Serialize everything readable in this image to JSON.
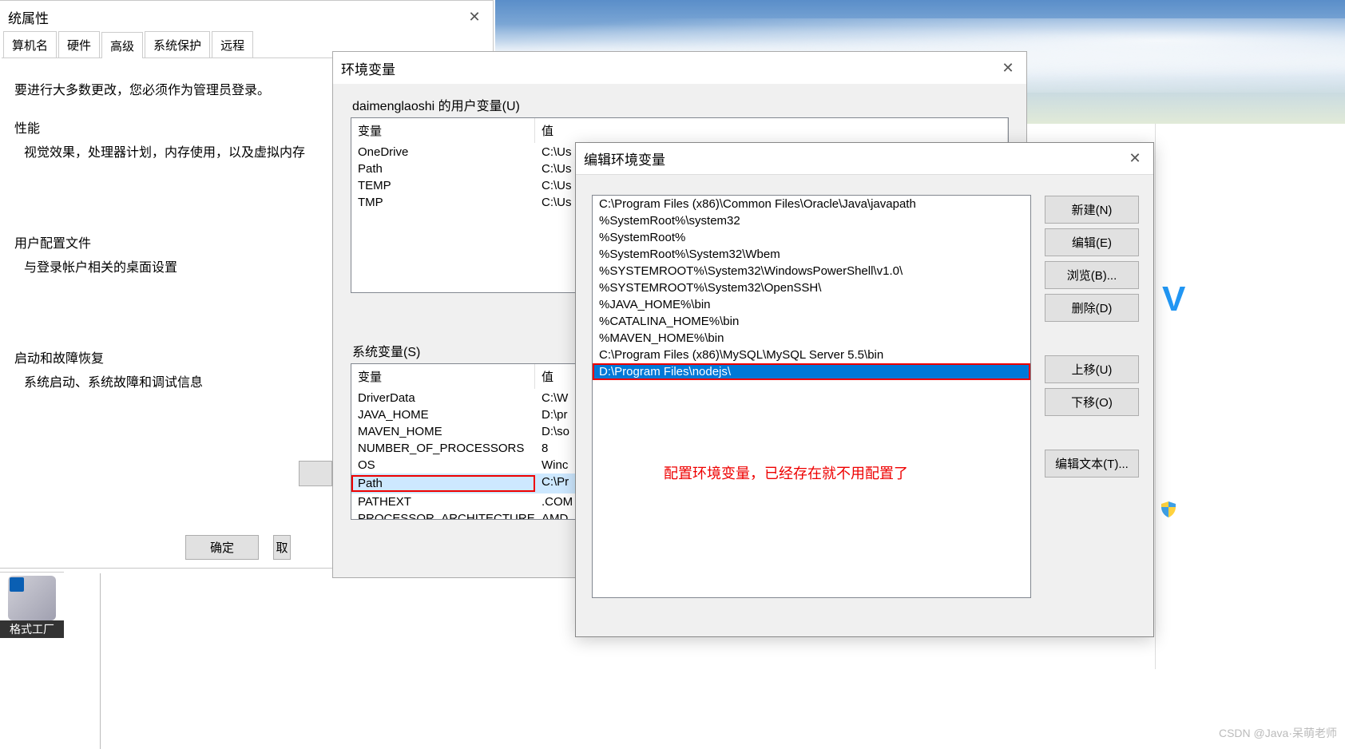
{
  "desktop": {
    "side_letter": "V",
    "watermark": "CSDN @Java·呆萌老师",
    "taskbar_icon_label": "格式工厂"
  },
  "properties": {
    "title": "统属性",
    "tabs": [
      "算机名",
      "硬件",
      "高级",
      "系统保护",
      "远程"
    ],
    "active_tab": 2,
    "intro": "要进行大多数更改，您必须作为管理员登录。",
    "sections": [
      {
        "head": "性能",
        "desc": "视觉效果，处理器计划，内存使用，以及虚拟内存"
      },
      {
        "head": "用户配置文件",
        "desc": "与登录帐户相关的桌面设置"
      },
      {
        "head": "启动和故障恢复",
        "desc": "系统启动、系统故障和调试信息"
      }
    ],
    "buttons": {
      "ok": "确定",
      "cancel": "取"
    }
  },
  "envvar": {
    "title": "环境变量",
    "user_group": "daimenglaoshi 的用户变量(U)",
    "sys_group": "系统变量(S)",
    "col_var": "变量",
    "col_val": "值",
    "user_rows": [
      {
        "v": "OneDrive",
        "val": "C:\\Us"
      },
      {
        "v": "Path",
        "val": "C:\\Us"
      },
      {
        "v": "TEMP",
        "val": "C:\\Us"
      },
      {
        "v": "TMP",
        "val": "C:\\Us"
      }
    ],
    "sys_rows": [
      {
        "v": "DriverData",
        "val": "C:\\W"
      },
      {
        "v": "JAVA_HOME",
        "val": "D:\\pr"
      },
      {
        "v": "MAVEN_HOME",
        "val": "D:\\so"
      },
      {
        "v": "NUMBER_OF_PROCESSORS",
        "val": "8"
      },
      {
        "v": "OS",
        "val": "Winc"
      },
      {
        "v": "Path",
        "val": "C:\\Pr",
        "hl": true,
        "sel": true
      },
      {
        "v": "PATHEXT",
        "val": ".COM"
      },
      {
        "v": "PROCESSOR_ARCHITECTURE",
        "val": "AMD"
      }
    ]
  },
  "editenv": {
    "title": "编辑环境变量",
    "paths": [
      "C:\\Program Files (x86)\\Common Files\\Oracle\\Java\\javapath",
      "%SystemRoot%\\system32",
      "%SystemRoot%",
      "%SystemRoot%\\System32\\Wbem",
      "%SYSTEMROOT%\\System32\\WindowsPowerShell\\v1.0\\",
      "%SYSTEMROOT%\\System32\\OpenSSH\\",
      "%JAVA_HOME%\\bin",
      "%CATALINA_HOME%\\bin",
      "%MAVEN_HOME%\\bin",
      "C:\\Program Files (x86)\\MySQL\\MySQL Server 5.5\\bin",
      "D:\\Program Files\\nodejs\\"
    ],
    "selected_index": 10,
    "buttons": {
      "new": "新建(N)",
      "edit": "编辑(E)",
      "browse": "浏览(B)...",
      "delete": "删除(D)",
      "up": "上移(U)",
      "down": "下移(O)",
      "edittext": "编辑文本(T)..."
    },
    "annotation": "配置环境变量，已经存在就不用配置了"
  }
}
